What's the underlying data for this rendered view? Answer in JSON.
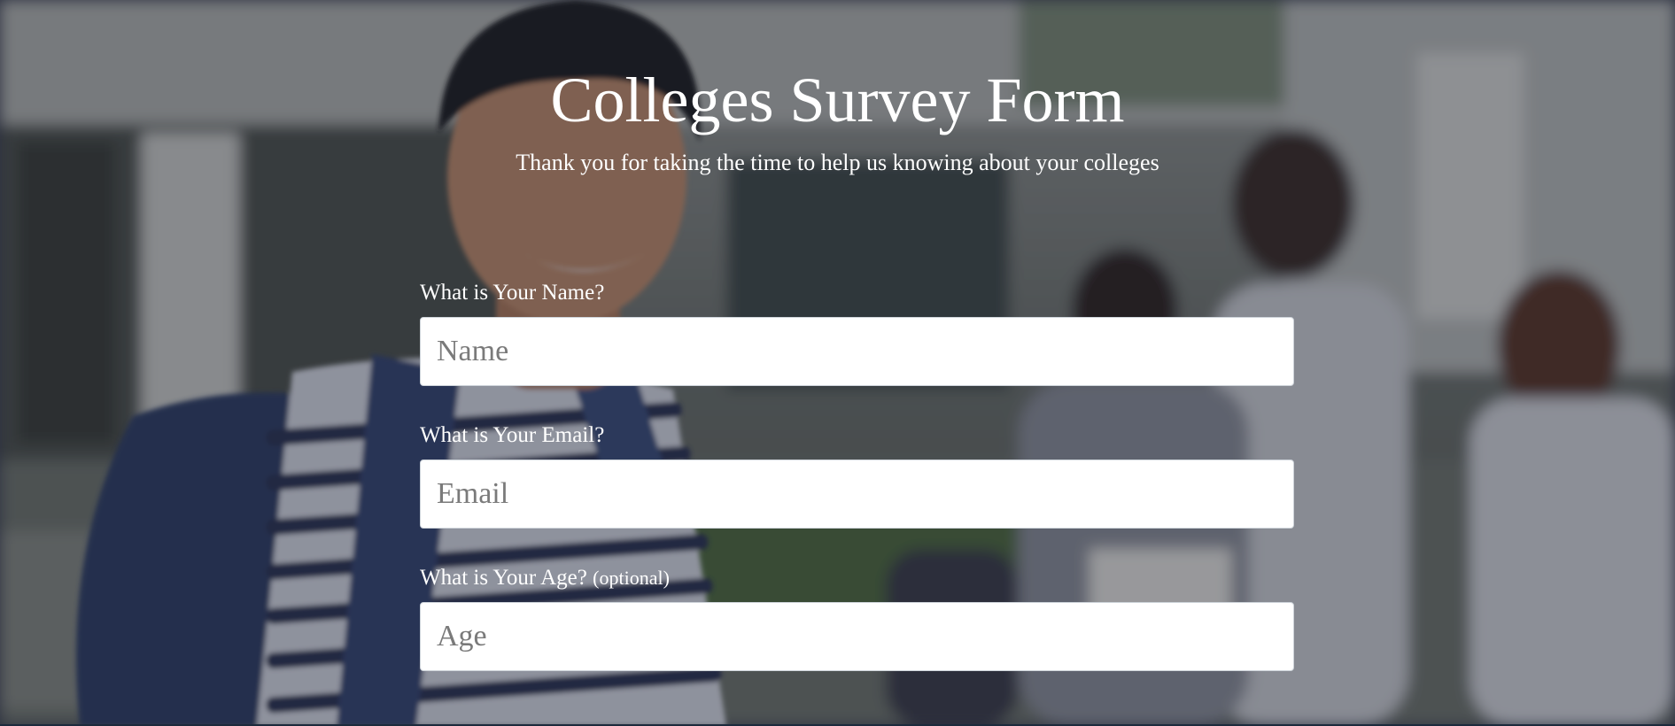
{
  "header": {
    "title": "Colleges Survey Form",
    "description": "Thank you for taking the time to help us knowing about your colleges"
  },
  "form": {
    "name": {
      "label": "What is Your Name?",
      "placeholder": "Name"
    },
    "email": {
      "label": "What is Your Email?",
      "placeholder": "Email"
    },
    "age": {
      "label": "What is Your Age?",
      "label_note": "(optional)",
      "placeholder": "Age"
    }
  },
  "colors": {
    "text": "#ffffff",
    "input_background": "#ffffff",
    "input_border": "#ced4da",
    "overlay": "#161a2c"
  }
}
